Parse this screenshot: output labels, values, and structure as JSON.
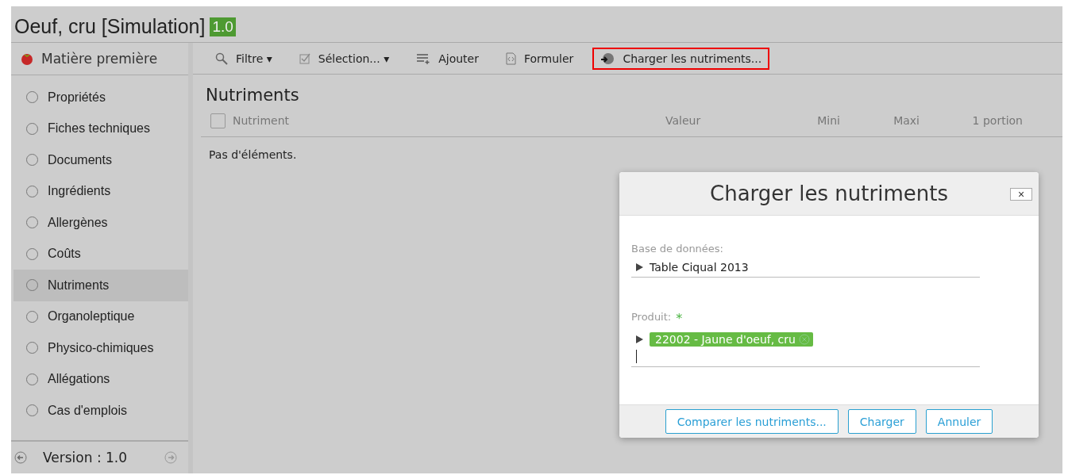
{
  "header": {
    "title": "Oeuf, cru [Simulation]",
    "version_badge": "1.0"
  },
  "sidebar": {
    "title": "Matière première",
    "items": [
      {
        "label": "Propriétés",
        "selected": false
      },
      {
        "label": "Fiches techniques",
        "selected": false
      },
      {
        "label": "Documents",
        "selected": false
      },
      {
        "label": "Ingrédients",
        "selected": false
      },
      {
        "label": "Allergènes",
        "selected": false
      },
      {
        "label": "Coûts",
        "selected": false
      },
      {
        "label": "Nutriments",
        "selected": true
      },
      {
        "label": "Organoleptique",
        "selected": false
      },
      {
        "label": "Physico-chimiques",
        "selected": false
      },
      {
        "label": "Allégations",
        "selected": false
      },
      {
        "label": "Cas d'emplois",
        "selected": false
      }
    ],
    "footer": "Version : 1.0"
  },
  "toolbar": [
    {
      "kind": "search",
      "label": "Filtre",
      "caret": "▾",
      "highlighted": false
    },
    {
      "kind": "check",
      "label": "Sélection...",
      "caret": "▾",
      "highlighted": false
    },
    {
      "kind": "add",
      "label": "Ajouter",
      "highlighted": false
    },
    {
      "kind": "code",
      "label": "Formuler",
      "highlighted": false
    },
    {
      "kind": "load",
      "label": "Charger les nutriments...",
      "highlighted": true
    }
  ],
  "section_title": "Nutriments",
  "table": {
    "select_all_checked": false,
    "columns": [
      "Nutriment",
      "Valeur",
      "Mini",
      "Maxi",
      "1 portion"
    ],
    "empty_text": "Pas d'éléments."
  },
  "dialog": {
    "title": "Charger les nutriments",
    "close": "×",
    "database": {
      "label": "Base de données:",
      "value": "Table Ciqual 2013"
    },
    "product": {
      "label": "Produit:",
      "required": "*",
      "tag": "22002 - Jaune d'oeuf, cru"
    },
    "buttons": [
      "Comparer les nutriments...",
      "Charger",
      "Annuler"
    ]
  }
}
